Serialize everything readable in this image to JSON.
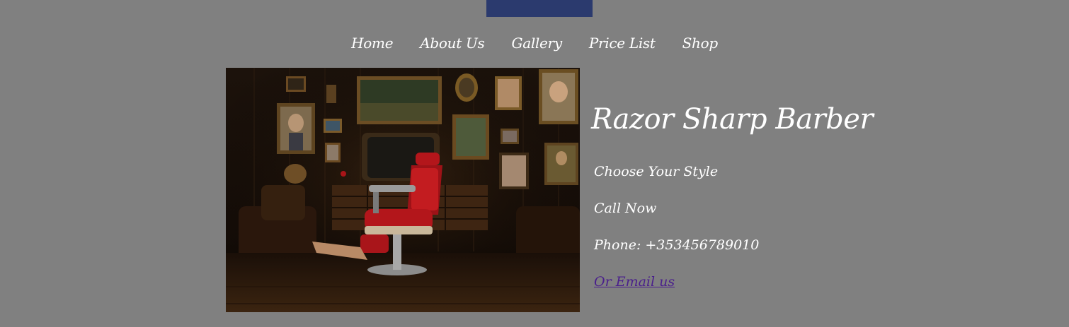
{
  "nav": {
    "items": [
      "Home",
      "About Us",
      "Gallery",
      "Price List",
      "Shop"
    ]
  },
  "hero": {
    "image_alt": "Barber shop interior with a red barber chair"
  },
  "info": {
    "title": "Razor Sharp Barber",
    "tagline": "Choose Your Style",
    "call": "Call Now",
    "phone": "Phone: +353456789010",
    "email_link": "Or Email us"
  },
  "colors": {
    "page_background": "#808080",
    "top_block": "#2b3a6e",
    "text": "#ffffff",
    "link": "#4a1f8c",
    "chair": "#b3161b"
  }
}
